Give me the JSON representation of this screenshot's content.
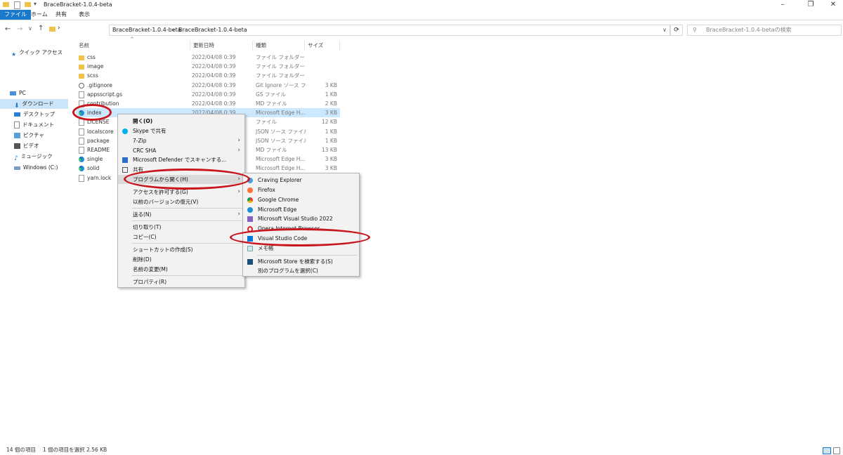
{
  "window": {
    "title": "BraceBracket-1.0.4-beta",
    "controls": {
      "minimize": "–",
      "maximize": "❐",
      "close": "✕"
    }
  },
  "ribbon": {
    "tabs": [
      {
        "label": "ファイル",
        "active": true
      },
      {
        "label": "ホーム",
        "active": false
      },
      {
        "label": "共有",
        "active": false
      },
      {
        "label": "表示",
        "active": false
      }
    ]
  },
  "address": {
    "path": [
      "BraceBracket-1.0.4-beta",
      "BraceBracket-1.0.4-beta"
    ],
    "separator": "›",
    "search_placeholder": "BraceBracket-1.0.4-betaの検索"
  },
  "nav": {
    "quick_access": "クイック アクセス",
    "items": [
      {
        "label": "PC",
        "selected": false
      },
      {
        "label": "ダウンロード",
        "selected": true
      },
      {
        "label": "デスクトップ",
        "selected": false
      },
      {
        "label": "ドキュメント",
        "selected": false
      },
      {
        "label": "ピクチャ",
        "selected": false
      },
      {
        "label": "ビデオ",
        "selected": false
      },
      {
        "label": "ミュージック",
        "selected": false
      },
      {
        "label": "Windows (C:)",
        "selected": false
      }
    ]
  },
  "columns": {
    "name": "名前",
    "date": "更新日時",
    "type": "種類",
    "size": "サイズ"
  },
  "files": [
    {
      "name": "css",
      "date": "2022/04/08 0:39",
      "type": "ファイル フォルダー",
      "size": "",
      "icon": "folder"
    },
    {
      "name": "image",
      "date": "2022/04/08 0:39",
      "type": "ファイル フォルダー",
      "size": "",
      "icon": "folder"
    },
    {
      "name": "scss",
      "date": "2022/04/08 0:39",
      "type": "ファイル フォルダー",
      "size": "",
      "icon": "folder"
    },
    {
      "name": ".gitignore",
      "date": "2022/04/08 0:39",
      "type": "Git Ignore ソース フ...",
      "size": "3 KB",
      "icon": "gear"
    },
    {
      "name": "appsscript.gs",
      "date": "2022/04/08 0:39",
      "type": "GS ファイル",
      "size": "1 KB",
      "icon": "doc"
    },
    {
      "name": "contribution",
      "date": "2022/04/08 0:39",
      "type": "MD ファイル",
      "size": "2 KB",
      "icon": "doc"
    },
    {
      "name": "index",
      "date": "2022/04/08 0:39",
      "type": "Microsoft Edge H...",
      "size": "3 KB",
      "icon": "edge"
    },
    {
      "name": "LICENSE",
      "date": "",
      "type": "ファイル",
      "size": "12 KB",
      "icon": "doc"
    },
    {
      "name": "localscore",
      "date": "",
      "type": "JSON ソース ファイル",
      "size": "1 KB",
      "icon": "doc"
    },
    {
      "name": "package",
      "date": "",
      "type": "JSON ソース ファイル",
      "size": "1 KB",
      "icon": "doc"
    },
    {
      "name": "README",
      "date": "",
      "type": "MD ファイル",
      "size": "13 KB",
      "icon": "doc"
    },
    {
      "name": "single",
      "date": "",
      "type": "Microsoft Edge H...",
      "size": "3 KB",
      "icon": "edge"
    },
    {
      "name": "solid",
      "date": "",
      "type": "Microsoft Edge H...",
      "size": "3 KB",
      "icon": "edge"
    },
    {
      "name": "yarn.lock",
      "date": "",
      "type": "",
      "size": "",
      "icon": "doc"
    }
  ],
  "context_menu": {
    "items": [
      {
        "label": "開く(O)",
        "bold": true,
        "arrow": ""
      },
      {
        "label": "Skype で共有",
        "arrow": ""
      },
      {
        "label": "7-Zip",
        "arrow": "›"
      },
      {
        "label": "CRC SHA",
        "arrow": "›"
      },
      {
        "label": "Microsoft Defender でスキャンする...",
        "arrow": ""
      },
      {
        "label": "共有",
        "arrow": ""
      },
      {
        "label": "プログラムから開く(H)",
        "arrow": "›"
      },
      {
        "label": "アクセスを許可する(G)",
        "arrow": "›"
      },
      {
        "label": "以前のバージョンの復元(V)",
        "arrow": ""
      },
      {
        "label": "送る(N)",
        "arrow": "›"
      },
      {
        "label": "切り取り(T)",
        "arrow": ""
      },
      {
        "label": "コピー(C)",
        "arrow": ""
      },
      {
        "label": "ショートカットの作成(S)",
        "arrow": ""
      },
      {
        "label": "削除(D)",
        "arrow": ""
      },
      {
        "label": "名前の変更(M)",
        "arrow": ""
      },
      {
        "label": "プロパティ(R)",
        "arrow": ""
      }
    ]
  },
  "open_with_menu": {
    "items": [
      {
        "label": "Craving Explorer"
      },
      {
        "label": "Firefox"
      },
      {
        "label": "Google Chrome"
      },
      {
        "label": "Microsoft Edge"
      },
      {
        "label": "Microsoft Visual Studio 2022"
      },
      {
        "label": "Opera Internet Browser"
      },
      {
        "label": "Visual Studio Code"
      },
      {
        "label": "メモ帳"
      },
      {
        "label": "Microsoft Store を検索する(S)"
      },
      {
        "label": "別のプログラムを選択(C)"
      }
    ]
  },
  "status": {
    "count": "14 個の項目",
    "selection": "1 個の項目を選択  2.56 KB"
  },
  "colors": {
    "accent": "#1979ca",
    "annotation": "#c8161d",
    "selection": "#cce8ff"
  }
}
